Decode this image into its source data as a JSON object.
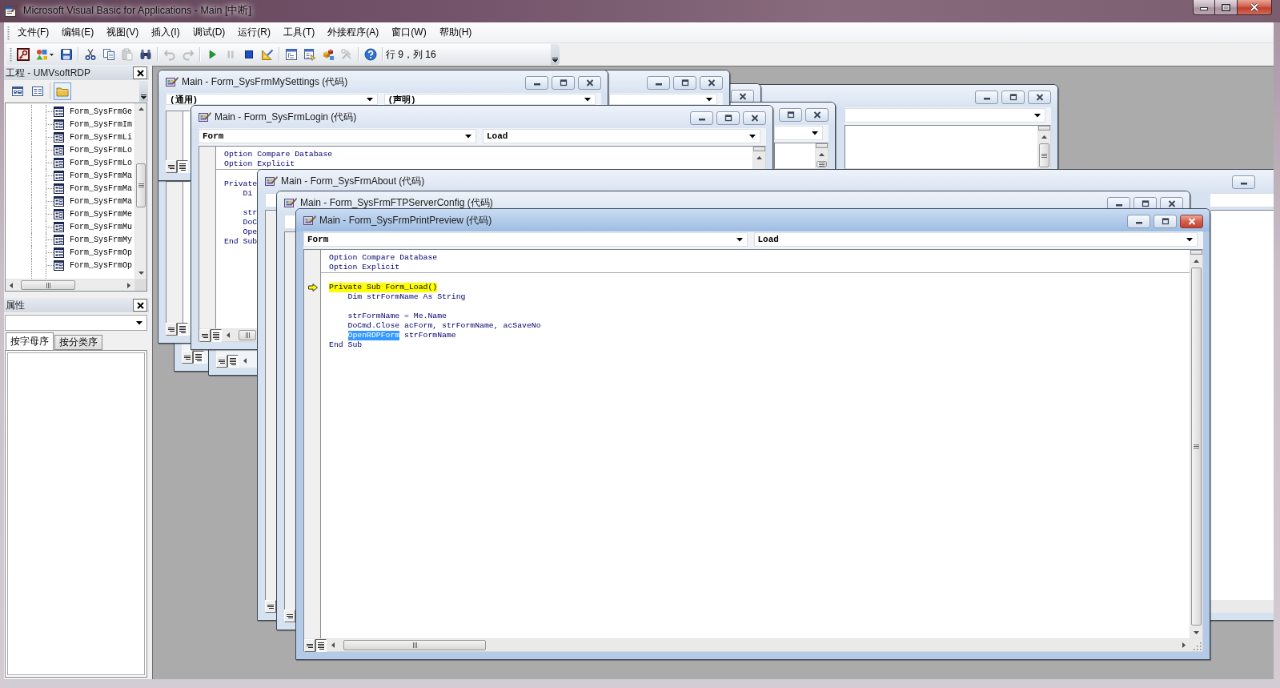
{
  "window": {
    "title": "Microsoft Visual Basic for Applications - Main [中断]"
  },
  "menu": [
    "文件(F)",
    "编辑(E)",
    "视图(V)",
    "插入(I)",
    "调试(D)",
    "运行(R)",
    "工具(T)",
    "外接程序(A)",
    "窗口(W)",
    "帮助(H)"
  ],
  "toolbar": {
    "groups": [
      {
        "buttons": [
          {
            "kind": "access",
            "disabled": false
          },
          {
            "kind": "insert",
            "disabled": false
          },
          {
            "kind": "save",
            "disabled": false
          }
        ]
      },
      {
        "buttons": [
          {
            "kind": "cut",
            "disabled": false
          },
          {
            "kind": "copy",
            "disabled": false
          },
          {
            "kind": "paste",
            "disabled": true
          },
          {
            "kind": "find",
            "disabled": false
          }
        ]
      },
      {
        "buttons": [
          {
            "kind": "undo",
            "disabled": true
          },
          {
            "kind": "redo",
            "disabled": true
          }
        ]
      },
      {
        "buttons": [
          {
            "kind": "run",
            "disabled": false
          },
          {
            "kind": "pause",
            "disabled": true
          },
          {
            "kind": "reset",
            "disabled": false
          },
          {
            "kind": "design",
            "disabled": false
          }
        ]
      },
      {
        "buttons": [
          {
            "kind": "project",
            "disabled": false
          },
          {
            "kind": "properties",
            "disabled": false
          },
          {
            "kind": "browser",
            "disabled": false
          },
          {
            "kind": "toolbox",
            "disabled": true
          }
        ]
      },
      {
        "buttons": [
          {
            "kind": "help",
            "disabled": false
          }
        ]
      }
    ],
    "position": "行 9，列 16"
  },
  "project": {
    "title": "工程 - UMVsoftRDP",
    "tools": [
      {
        "kind": "object",
        "pressed": false
      },
      {
        "kind": "code",
        "pressed": false
      },
      {
        "kind": "folders",
        "pressed": true
      }
    ],
    "items": [
      "Form_SysFrmGe",
      "Form_SysFrmIm",
      "Form_SysFrmLi",
      "Form_SysFrmLo",
      "Form_SysFrmLo",
      "Form_SysFrmMa",
      "Form_SysFrmMa",
      "Form_SysFrmMa",
      "Form_SysFrmMe",
      "Form_SysFrmMu",
      "Form_SysFrmMy",
      "Form_SysFrmOp",
      "Form_SysFrmOp"
    ]
  },
  "properties": {
    "title": "属性",
    "tabs": [
      {
        "label": "按字母序",
        "selected": true
      },
      {
        "label": "按分类序",
        "selected": false
      }
    ]
  },
  "code_windows": [
    {
      "active": false
    },
    {
      "active": false
    },
    {
      "active": false
    },
    {
      "active": false
    },
    {
      "views": [
        {
          "kind": "procedure",
          "selected": false
        },
        {
          "kind": "module",
          "selected": true
        }
      ]
    },
    {
      "views": [
        {
          "kind": "procedure",
          "selected": false
        },
        {
          "kind": "module",
          "selected": true
        }
      ]
    },
    {
      "views": [
        {
          "kind": "procedure",
          "selected": false
        },
        {
          "kind": "module",
          "selected": true
        }
      ]
    },
    {
      "title": "Main - Form_SysFrmMySettings (代码)",
      "active": false,
      "object": "(通用)",
      "procedure": "(声明)",
      "views": [
        {
          "kind": "procedure",
          "selected": false
        },
        {
          "kind": "module",
          "selected": true
        }
      ]
    },
    {
      "title": "Main - Form_SysFrmLogin (代码)",
      "active": false,
      "object": "Form",
      "procedure": "Load",
      "code": [
        {
          "lines": [
            {
              "kind": "code",
              "current": false,
              "text": "Option Compare Database"
            },
            {
              "kind": "code",
              "current": false,
              "text": "Option Explicit"
            }
          ]
        },
        {
          "lines": [
            {
              "kind": "blank"
            },
            {
              "kind": "code",
              "current": false,
              "text": "Private",
              "children": [
                {
                  "kind": "code",
                  "current": false,
                  "text": "Di"
                },
                {
                  "kind": "blank"
                },
                {
                  "kind": "code",
                  "current": false,
                  "text": "str"
                },
                {
                  "kind": "code",
                  "current": false,
                  "text": "DoC"
                },
                {
                  "kind": "code",
                  "current": false,
                  "text": "Ope"
                }
              ]
            },
            {
              "kind": "code",
              "current": false,
              "text": "End Sub"
            }
          ]
        }
      ],
      "views": [
        {
          "kind": "procedure",
          "selected": false
        },
        {
          "kind": "module",
          "selected": true
        }
      ]
    },
    {
      "title": "Main - Form_SysFrmAbout (代码)",
      "active": false,
      "views": [
        {
          "kind": "procedure",
          "selected": false
        }
      ]
    },
    {
      "title": "Main - Form_SysFrmFTPServerConfig (代码)",
      "active": false,
      "views": [
        {
          "kind": "procedure",
          "selected": false
        }
      ]
    },
    {
      "title": "Main - Form_SysFrmPrintPreview (代码)",
      "active": true,
      "object": "Form",
      "procedure": "Load",
      "code": [
        {
          "lines": [
            {
              "kind": "code",
              "current": false,
              "text": "Option Compare Database"
            },
            {
              "kind": "code",
              "current": false,
              "text": "Option Explicit"
            }
          ]
        },
        {
          "lines": [
            {
              "kind": "blank"
            },
            {
              "kind": "code",
              "current": true,
              "text": "Private Sub Form_Load()",
              "children": [
                {
                  "kind": "code",
                  "current": false,
                  "text": "Dim strFormName As String"
                },
                {
                  "kind": "blank"
                },
                {
                  "kind": "code",
                  "current": false,
                  "text": "strFormName = Me.Name"
                },
                {
                  "kind": "code",
                  "current": false,
                  "text": "DoCmd.Close acForm, strFormName, acSaveNo"
                },
                {
                  "kind": "code",
                  "current": false,
                  "segments": [
                    {
                      "text": "OpenRDPForm",
                      "selected": true
                    },
                    {
                      "text": "strFormName",
                      "selected": false
                    }
                  ]
                }
              ]
            },
            {
              "kind": "code",
              "current": false,
              "text": "End Sub"
            }
          ]
        }
      ],
      "views": [
        {
          "kind": "procedure",
          "selected": false
        },
        {
          "kind": "module",
          "selected": true
        }
      ]
    }
  ]
}
